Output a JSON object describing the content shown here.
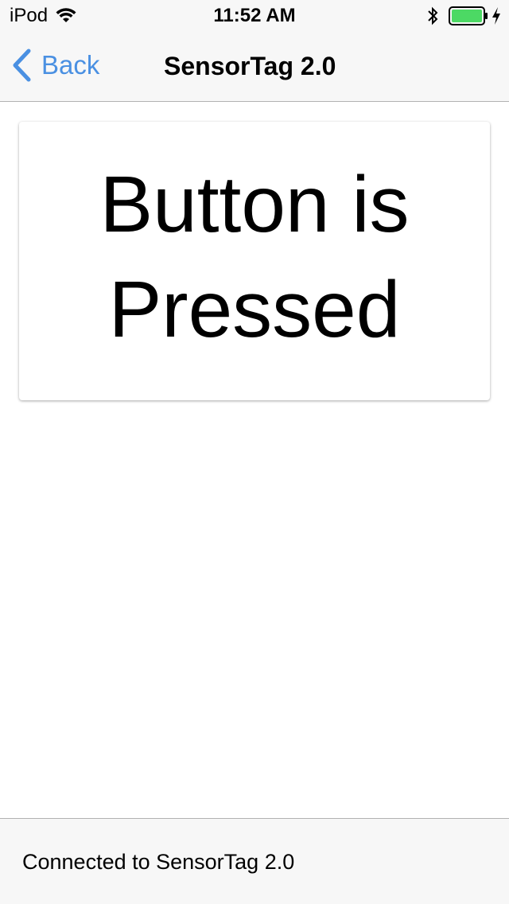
{
  "status_bar": {
    "carrier": "iPod",
    "time": "11:52 AM",
    "battery_color": "#4cd964"
  },
  "nav": {
    "back_label": "Back",
    "title": "SensorTag 2.0",
    "accent_color": "#4a90e2"
  },
  "main": {
    "button_status": "Button is Pressed"
  },
  "footer": {
    "connection_status": "Connected to SensorTag 2.0"
  }
}
